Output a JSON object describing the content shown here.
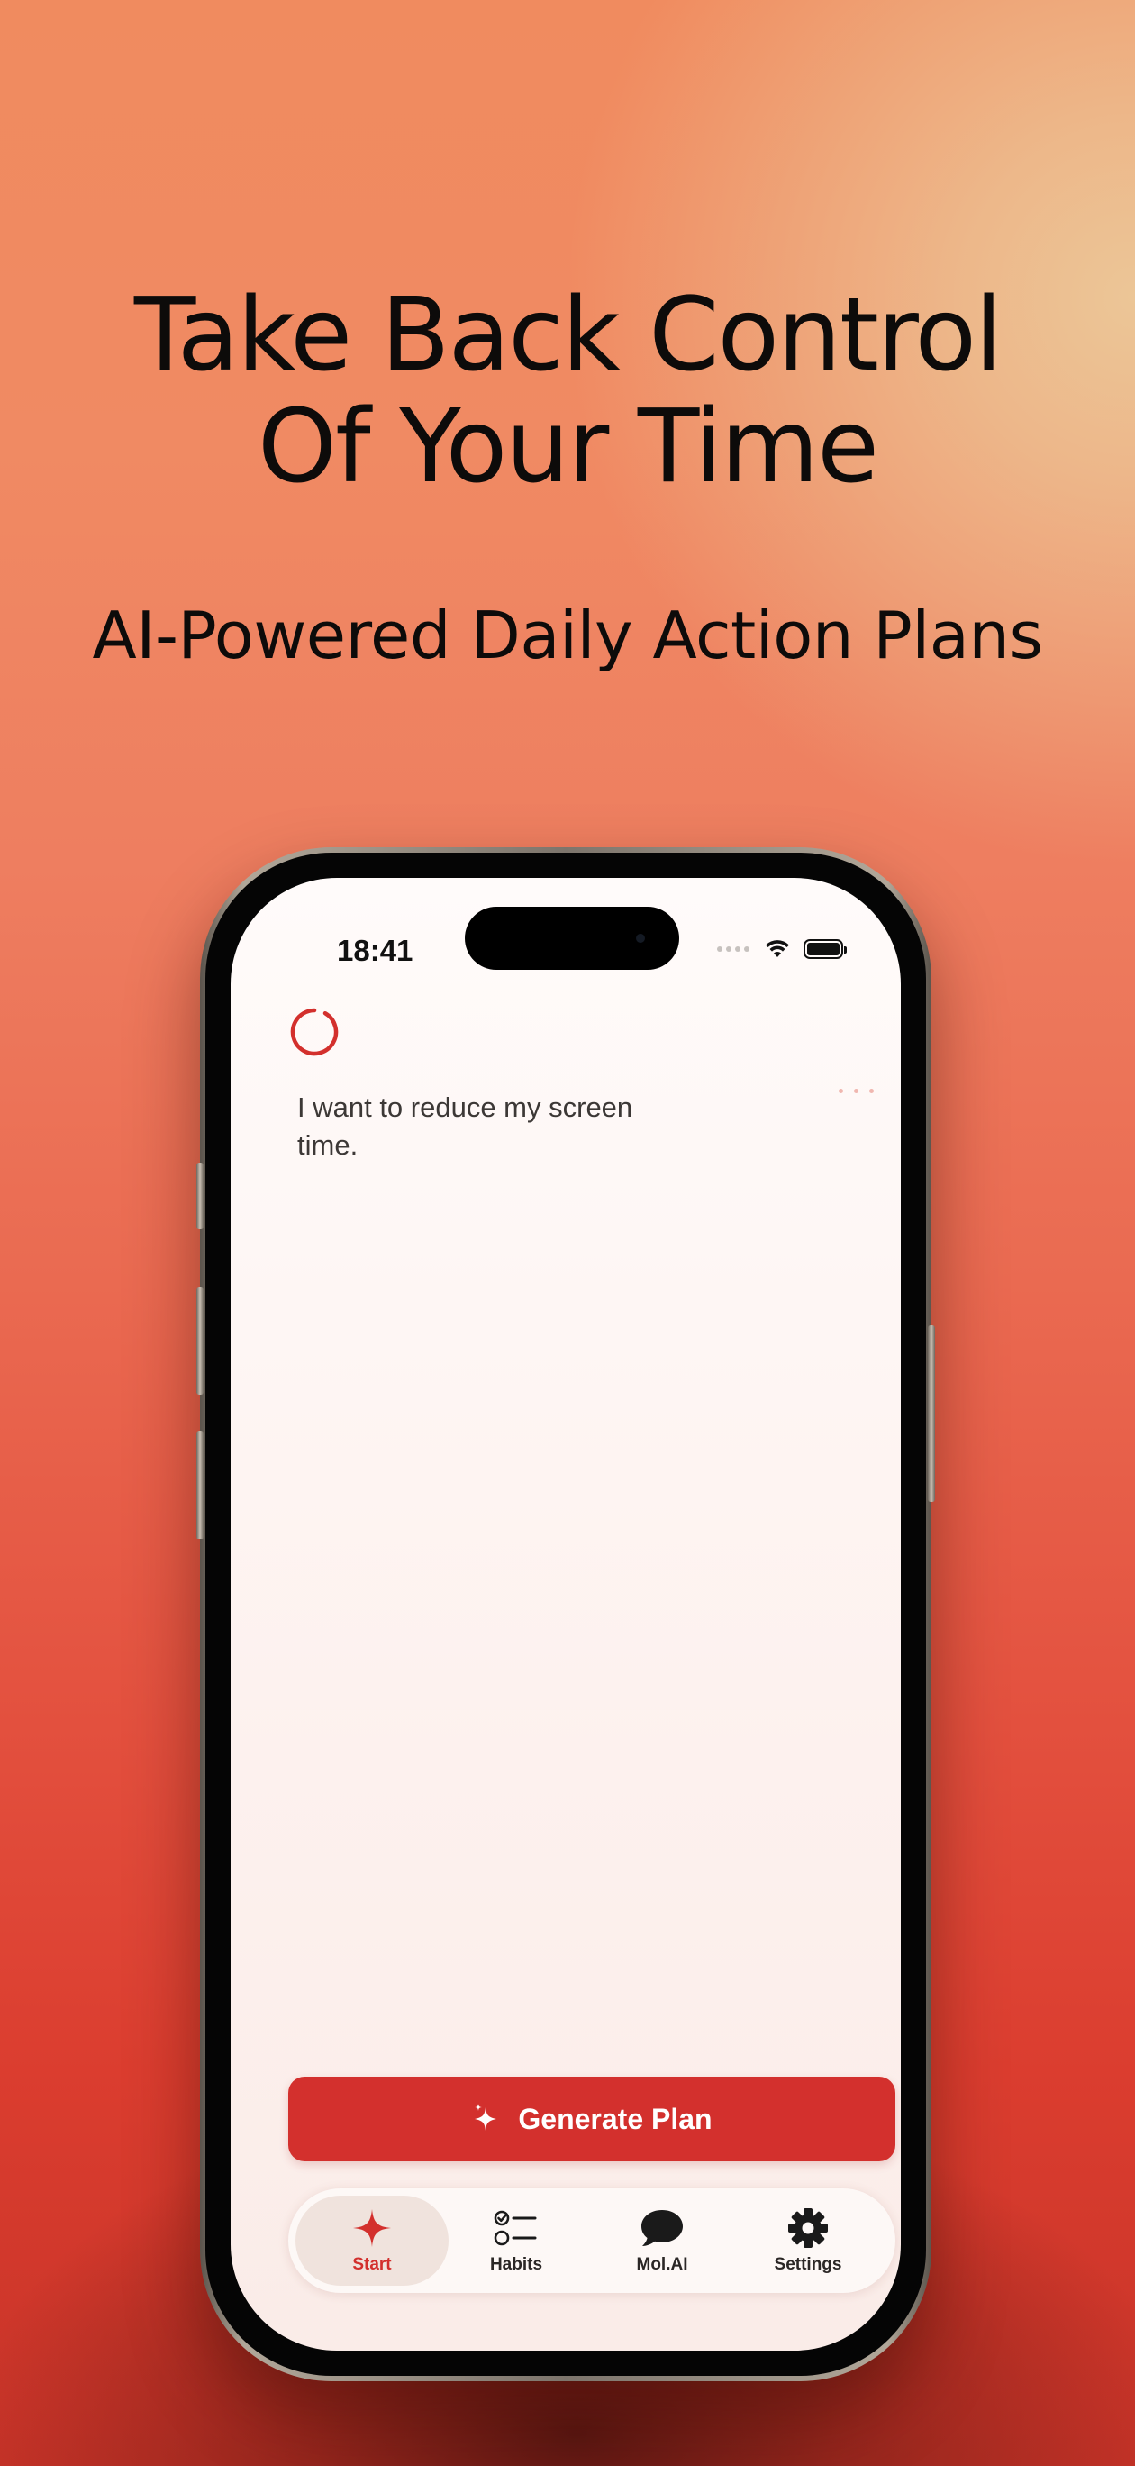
{
  "headline": {
    "line1": "Take Back Control",
    "line2": "Of Your Time"
  },
  "subheadline": "AI-Powered Daily Action Plans",
  "phone": {
    "status_bar": {
      "time": "18:41",
      "icons": [
        "signal-icon",
        "wifi-icon",
        "battery-icon"
      ]
    },
    "screen": {
      "prompt_text": "I want to reduce my screen time.",
      "loading_indicator": "progress-ring-icon",
      "typing_indicator": "ellipsis-icon"
    },
    "generate_button": {
      "label": "Generate Plan",
      "icon": "sparkle-icon"
    },
    "tab_bar": {
      "tabs": [
        {
          "label": "Start",
          "icon": "star-icon",
          "active": true
        },
        {
          "label": "Habits",
          "icon": "checklist-icon",
          "active": false
        },
        {
          "label": "Mol.AI",
          "icon": "chat-bubble-icon",
          "active": false
        },
        {
          "label": "Settings",
          "icon": "gear-icon",
          "active": false
        }
      ]
    }
  },
  "colors": {
    "accent": "#d3302d",
    "background_top": "#f08b5f",
    "background_bottom": "#c73328",
    "screen_bg": "#fdf1ee"
  }
}
